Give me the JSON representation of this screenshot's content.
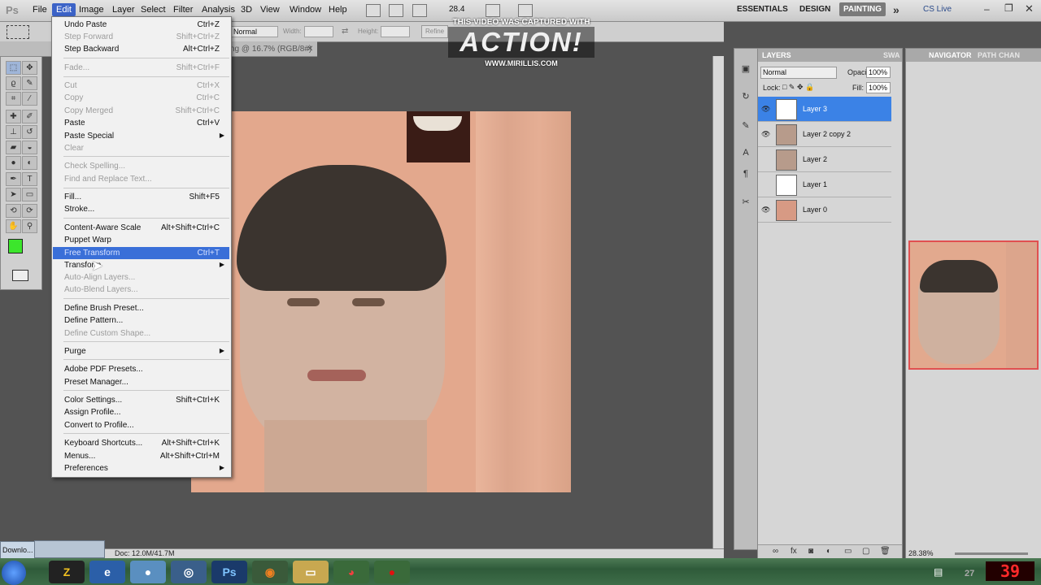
{
  "app": {
    "logo": "Ps"
  },
  "menubar": {
    "items": [
      "File",
      "Edit",
      "Image",
      "Layer",
      "Select",
      "Filter",
      "Analysis",
      "3D",
      "View",
      "Window",
      "Help"
    ],
    "zoom": "28.4",
    "workspaces": [
      "ESSENTIALS",
      "DESIGN",
      "PAINTING"
    ],
    "more": "»",
    "cslive": "CS Live"
  },
  "options": {
    "mode": "Normal",
    "width_label": "Width:",
    "height_label": "Height:",
    "refine": "Refine"
  },
  "document": {
    "title": "ng @ 16.7% (RGB/8#)",
    "doc_info": "Doc: 12.0M/41.7M"
  },
  "watermark": {
    "line1": "THIS VIDEO WAS CAPTURED WITH",
    "line2": "ACTION!",
    "line3": "WWW.MIRILLIS.COM"
  },
  "edit_menu": {
    "items": [
      {
        "label": "Undo Paste",
        "shortcut": "Ctrl+Z"
      },
      {
        "label": "Step Forward",
        "shortcut": "Shift+Ctrl+Z",
        "disabled": true
      },
      {
        "label": "Step Backward",
        "shortcut": "Alt+Ctrl+Z"
      },
      {
        "label": "Fade...",
        "shortcut": "Shift+Ctrl+F",
        "disabled": true
      },
      {
        "label": "Cut",
        "shortcut": "Ctrl+X",
        "disabled": true
      },
      {
        "label": "Copy",
        "shortcut": "Ctrl+C",
        "disabled": true
      },
      {
        "label": "Copy Merged",
        "shortcut": "Shift+Ctrl+C",
        "disabled": true
      },
      {
        "label": "Paste",
        "shortcut": "Ctrl+V"
      },
      {
        "label": "Paste Special",
        "shortcut": ""
      },
      {
        "label": "Clear",
        "shortcut": "",
        "disabled": true
      },
      {
        "label": "Check Spelling...",
        "shortcut": "",
        "disabled": true
      },
      {
        "label": "Find and Replace Text...",
        "shortcut": "",
        "disabled": true
      },
      {
        "label": "Fill...",
        "shortcut": "Shift+F5"
      },
      {
        "label": "Stroke...",
        "shortcut": ""
      },
      {
        "label": "Content-Aware Scale",
        "shortcut": "Alt+Shift+Ctrl+C"
      },
      {
        "label": "Puppet Warp",
        "shortcut": ""
      },
      {
        "label": "Free Transform",
        "shortcut": "Ctrl+T"
      },
      {
        "label": "Transform",
        "shortcut": ""
      },
      {
        "label": "Auto-Align Layers...",
        "shortcut": "",
        "disabled": true
      },
      {
        "label": "Auto-Blend Layers...",
        "shortcut": "",
        "disabled": true
      },
      {
        "label": "Define Brush Preset...",
        "shortcut": ""
      },
      {
        "label": "Define Pattern...",
        "shortcut": ""
      },
      {
        "label": "Define Custom Shape...",
        "shortcut": "",
        "disabled": true
      },
      {
        "label": "Purge",
        "shortcut": ""
      },
      {
        "label": "Adobe PDF Presets...",
        "shortcut": ""
      },
      {
        "label": "Preset Manager...",
        "shortcut": ""
      },
      {
        "label": "Color Settings...",
        "shortcut": "Shift+Ctrl+K"
      },
      {
        "label": "Assign Profile...",
        "shortcut": ""
      },
      {
        "label": "Convert to Profile...",
        "shortcut": ""
      },
      {
        "label": "Keyboard Shortcuts...",
        "shortcut": "Alt+Shift+Ctrl+K"
      },
      {
        "label": "Menus...",
        "shortcut": "Alt+Shift+Ctrl+M"
      },
      {
        "label": "Preferences",
        "shortcut": ""
      }
    ]
  },
  "layers_panel": {
    "tabs": [
      "LAYERS",
      "SWA"
    ],
    "blend_mode": "Normal",
    "opacity_label": "Opacity:",
    "opacity": "100%",
    "lock_label": "Lock:",
    "fill_label": "Fill:",
    "fill": "100%",
    "layers": [
      {
        "name": "Layer 3",
        "selected": true
      },
      {
        "name": "Layer 2 copy 2"
      },
      {
        "name": "Layer 2"
      },
      {
        "name": "Layer 1"
      },
      {
        "name": "Layer 0"
      }
    ]
  },
  "navigator_panel": {
    "tabs": [
      "NAVIGATOR",
      "PATH",
      "CHAN"
    ],
    "zoom": "28.38%"
  },
  "taskbar": {
    "download": "Downlo...",
    "ps_label": "Ps",
    "clock": "39",
    "clock_small": "27"
  },
  "colors": {
    "foreground": "#3ce62c",
    "accent": "#3a6fd8"
  }
}
